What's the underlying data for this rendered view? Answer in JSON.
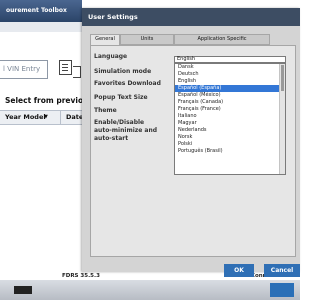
{
  "background_app": {
    "tab_title": "ourement Toolbox",
    "vin_placeholder": "l VIN Entry",
    "prev_label": "Select from previous VI",
    "table_headers": [
      "Year Model",
      "Date"
    ],
    "status_version": "FDRS 35.5.3",
    "status_connection": "Not Connected: Click th"
  },
  "dialog": {
    "title": "User Settings",
    "tabs": [
      "General",
      "Units",
      "Application Specific"
    ],
    "labels": {
      "language": "Language",
      "simulation": "Simulation mode",
      "favorites": "Favorites Download",
      "popup": "Popup Text Size",
      "theme": "Theme",
      "auto_min_1": "Enable/Disable",
      "auto_min_2": "auto-minimize and",
      "auto_min_3": "auto-start"
    },
    "language_selected": "English",
    "language_options": [
      "Dansk",
      "Deutsch",
      "English",
      "Español (España)",
      "Español (México)",
      "Français (Canada)",
      "Français (France)",
      "Italiano",
      "Magyar",
      "Nederlands",
      "Norsk",
      "Polski",
      "Português (Brasil)"
    ],
    "highlighted_option": "Español (España)",
    "ok_label": "OK",
    "cancel_label": "Cancel"
  }
}
